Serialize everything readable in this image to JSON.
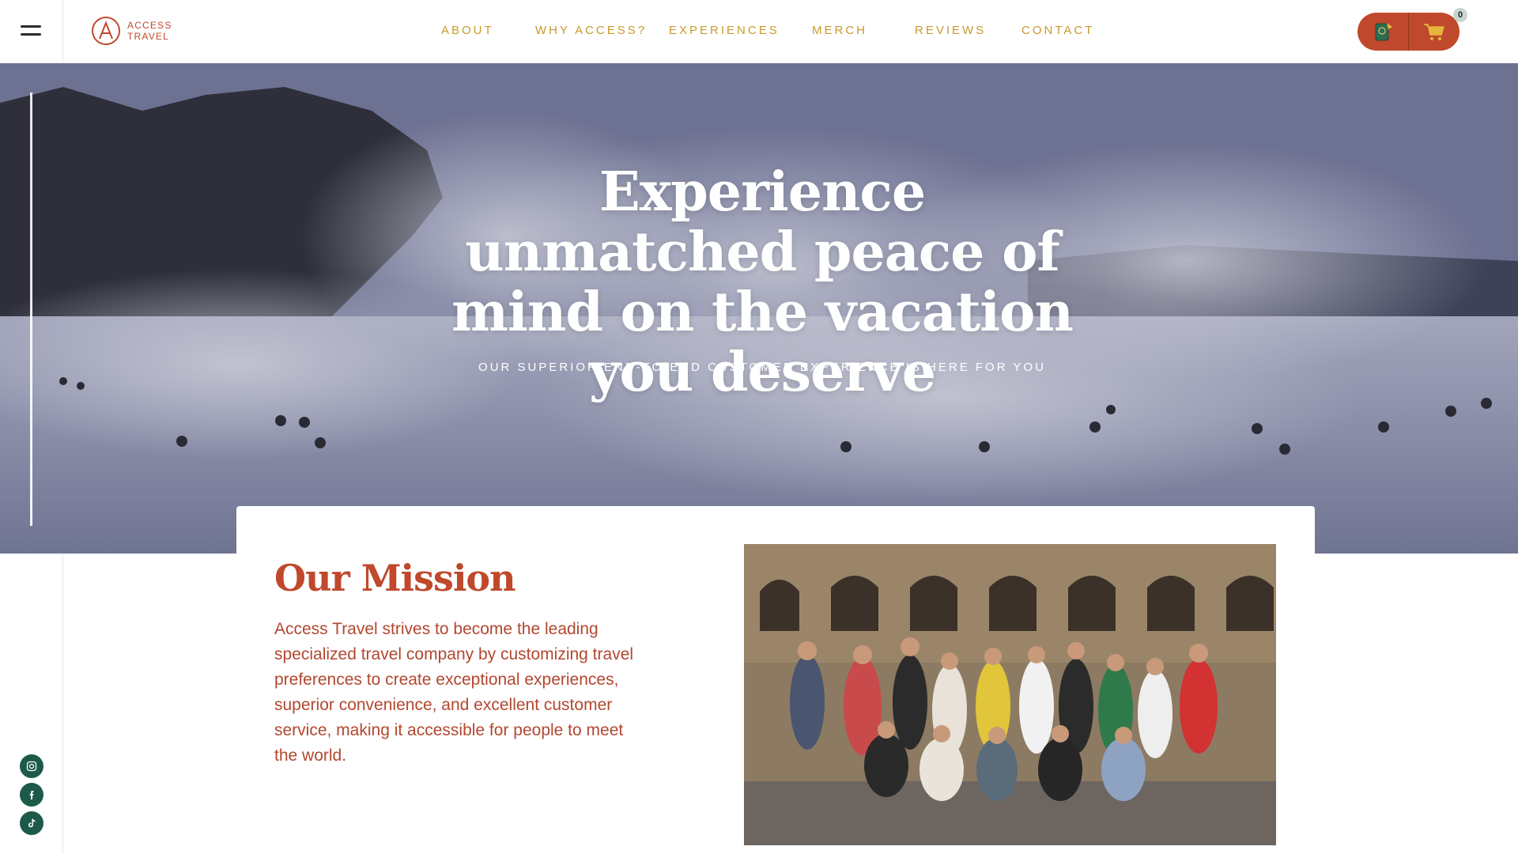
{
  "header": {
    "logo": {
      "line1": "ACCESS",
      "line2": "TRAVEL"
    },
    "nav": [
      "ABOUT",
      "WHY ACCESS?",
      "EXPERIENCES",
      "MERCH",
      "REVIEWS",
      "CONTACT"
    ],
    "cart_count": "0"
  },
  "hero": {
    "title": "Experience unmatched peace of mind on the vacation you deserve",
    "subtitle": "OUR SUPERIOR END-TO-END CUSTOMER EXPERIENCE IS HERE FOR YOU"
  },
  "mission": {
    "title": "Our Mission",
    "text": "Access Travel strives to become the leading specialized travel company by customizing travel preferences to create exceptional experiences, superior convenience, and excellent customer service, making it accessible for people to meet the world."
  },
  "social": [
    "instagram-icon",
    "facebook-icon",
    "tiktok-icon"
  ],
  "colors": {
    "brand": "#c0482c",
    "nav": "#c89a2a",
    "social": "#1d5a4a"
  }
}
